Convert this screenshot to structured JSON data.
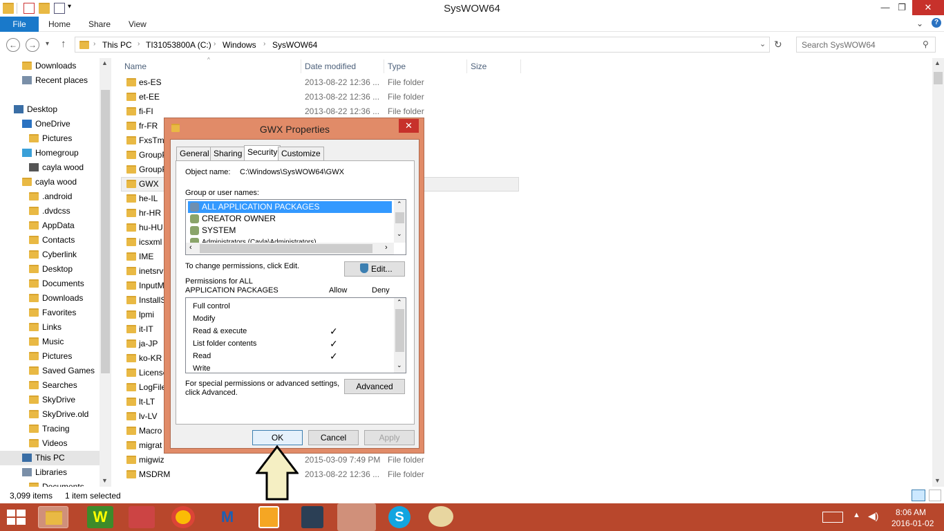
{
  "window": {
    "title": "SysWOW64",
    "min_icon": "minimize-icon",
    "max_icon": "maximize-icon",
    "close_icon": "close-icon"
  },
  "ribbon": {
    "file": "File",
    "tabs": [
      "Home",
      "Share",
      "View"
    ]
  },
  "address": {
    "crumbs": [
      "This PC",
      "TI31053800A (C:)",
      "Windows",
      "SysWOW64"
    ],
    "search_placeholder": "Search SysWOW64"
  },
  "nav": {
    "items": [
      {
        "label": "Downloads",
        "indent": 1,
        "icon": "folder-icon"
      },
      {
        "label": "Recent places",
        "indent": 1,
        "icon": "recent-icon"
      },
      {
        "label": "Desktop",
        "indent": 0,
        "icon": "desktop-icon"
      },
      {
        "label": "OneDrive",
        "indent": 1,
        "icon": "cloud-icon"
      },
      {
        "label": "Pictures",
        "indent": 2,
        "icon": "folder-icon"
      },
      {
        "label": "Homegroup",
        "indent": 1,
        "icon": "homegroup-icon"
      },
      {
        "label": "cayla wood",
        "indent": 2,
        "icon": "user-icon"
      },
      {
        "label": "cayla wood",
        "indent": 1,
        "icon": "user-folder-icon"
      },
      {
        "label": ".android",
        "indent": 2,
        "icon": "folder-icon"
      },
      {
        "label": ".dvdcss",
        "indent": 2,
        "icon": "folder-icon"
      },
      {
        "label": "AppData",
        "indent": 2,
        "icon": "folder-icon"
      },
      {
        "label": "Contacts",
        "indent": 2,
        "icon": "folder-icon"
      },
      {
        "label": "Cyberlink",
        "indent": 2,
        "icon": "folder-icon"
      },
      {
        "label": "Desktop",
        "indent": 2,
        "icon": "folder-icon"
      },
      {
        "label": "Documents",
        "indent": 2,
        "icon": "folder-icon"
      },
      {
        "label": "Downloads",
        "indent": 2,
        "icon": "folder-icon"
      },
      {
        "label": "Favorites",
        "indent": 2,
        "icon": "folder-icon"
      },
      {
        "label": "Links",
        "indent": 2,
        "icon": "folder-icon"
      },
      {
        "label": "Music",
        "indent": 2,
        "icon": "folder-icon"
      },
      {
        "label": "Pictures",
        "indent": 2,
        "icon": "folder-icon"
      },
      {
        "label": "Saved Games",
        "indent": 2,
        "icon": "folder-icon"
      },
      {
        "label": "Searches",
        "indent": 2,
        "icon": "folder-icon"
      },
      {
        "label": "SkyDrive",
        "indent": 2,
        "icon": "folder-icon"
      },
      {
        "label": "SkyDrive.old",
        "indent": 2,
        "icon": "folder-icon"
      },
      {
        "label": "Tracing",
        "indent": 2,
        "icon": "folder-icon"
      },
      {
        "label": "Videos",
        "indent": 2,
        "icon": "folder-icon"
      },
      {
        "label": "This PC",
        "indent": 1,
        "icon": "computer-icon"
      },
      {
        "label": "Libraries",
        "indent": 1,
        "icon": "library-icon"
      },
      {
        "label": "Documents",
        "indent": 2,
        "icon": "folder-icon"
      }
    ]
  },
  "list": {
    "columns": {
      "name": "Name",
      "date": "Date modified",
      "type": "Type",
      "size": "Size"
    },
    "rows": [
      {
        "name": "es-ES",
        "date": "2013-08-22 12:36 ...",
        "type": "File folder"
      },
      {
        "name": "et-EE",
        "date": "2013-08-22 12:36 ...",
        "type": "File folder"
      },
      {
        "name": "fi-FI",
        "date": "2013-08-22 12:36 ...",
        "type": "File folder"
      },
      {
        "name": "fr-FR",
        "date": "",
        "type": ""
      },
      {
        "name": "FxsTmp",
        "date": "",
        "type": ""
      },
      {
        "name": "GroupP",
        "date": "",
        "type": ""
      },
      {
        "name": "GroupP",
        "date": "",
        "type": ""
      },
      {
        "name": "GWX",
        "date": "",
        "type": ""
      },
      {
        "name": "he-IL",
        "date": "",
        "type": ""
      },
      {
        "name": "hr-HR",
        "date": "",
        "type": ""
      },
      {
        "name": "hu-HU",
        "date": "",
        "type": ""
      },
      {
        "name": "icsxml",
        "date": "",
        "type": ""
      },
      {
        "name": "IME",
        "date": "",
        "type": ""
      },
      {
        "name": "inetsrv",
        "date": "",
        "type": ""
      },
      {
        "name": "InputM",
        "date": "",
        "type": ""
      },
      {
        "name": "InstallS",
        "date": "",
        "type": ""
      },
      {
        "name": "lpmi",
        "date": "",
        "type": ""
      },
      {
        "name": "it-IT",
        "date": "",
        "type": ""
      },
      {
        "name": "ja-JP",
        "date": "",
        "type": ""
      },
      {
        "name": "ko-KR",
        "date": "",
        "type": ""
      },
      {
        "name": "License",
        "date": "",
        "type": ""
      },
      {
        "name": "LogFile",
        "date": "",
        "type": ""
      },
      {
        "name": "lt-LT",
        "date": "",
        "type": ""
      },
      {
        "name": "lv-LV",
        "date": "",
        "type": ""
      },
      {
        "name": "Macro",
        "date": "",
        "type": ""
      },
      {
        "name": "migrat",
        "date": "",
        "type": ""
      },
      {
        "name": "migwiz",
        "date": "2015-03-09 7:49 PM",
        "type": "File folder"
      },
      {
        "name": "MSDRM",
        "date": "2013-08-22 12:36 ...",
        "type": "File folder"
      }
    ]
  },
  "status": {
    "count": "3,099 items",
    "selected": "1 item selected"
  },
  "dialog": {
    "title": "GWX Properties",
    "tabs": [
      "General",
      "Sharing",
      "Security",
      "Customize"
    ],
    "object_label": "Object name:",
    "object_value": "C:\\Windows\\SysWOW64\\GWX",
    "group_label": "Group or user names:",
    "users": [
      "ALL APPLICATION PACKAGES",
      "CREATOR OWNER",
      "SYSTEM",
      "Administrators (Cayla\\Administrators)"
    ],
    "change_text": "To change permissions, click Edit.",
    "edit_label": "Edit...",
    "perm_for_line1": "Permissions for ALL",
    "perm_for_line2": "APPLICATION PACKAGES",
    "allow": "Allow",
    "deny": "Deny",
    "permissions": [
      {
        "name": "Full control",
        "allow": ""
      },
      {
        "name": "Modify",
        "allow": ""
      },
      {
        "name": "Read & execute",
        "allow": "✓"
      },
      {
        "name": "List folder contents",
        "allow": "✓"
      },
      {
        "name": "Read",
        "allow": "✓"
      },
      {
        "name": "Write",
        "allow": ""
      }
    ],
    "special_line1": "For special permissions or advanced settings,",
    "special_line2": "click Advanced.",
    "advanced_label": "Advanced",
    "ok": "OK",
    "cancel": "Cancel",
    "apply": "Apply"
  },
  "tray": {
    "time": "8:06 AM",
    "date": "2016-01-02"
  },
  "colors": {
    "taskbar": "#b8472c",
    "dialog_frame": "#e18b68",
    "accent": "#1979ca"
  }
}
